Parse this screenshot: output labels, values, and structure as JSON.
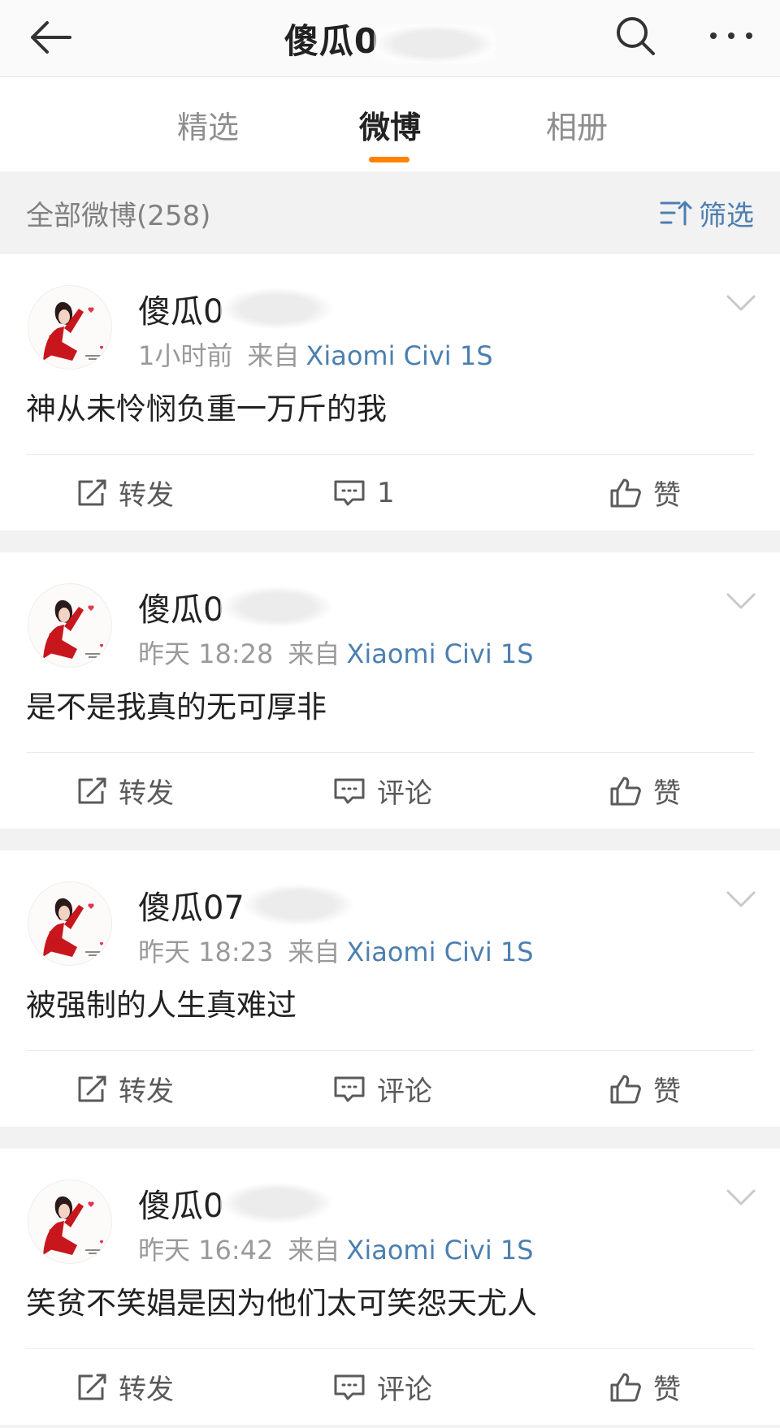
{
  "header": {
    "title": "傻瓜0",
    "back_icon": "arrow-left-icon",
    "search_icon": "search-icon",
    "more_icon": "more-dots-icon"
  },
  "tabs": [
    {
      "label": "精选",
      "active": false
    },
    {
      "label": "微博",
      "active": true
    },
    {
      "label": "相册",
      "active": false
    }
  ],
  "accent_color": "#ff8200",
  "link_color": "#4c7fb0",
  "filter_bar": {
    "count_label": "全部微博(258)",
    "filter_label": "筛选",
    "filter_icon": "filter-sort-icon"
  },
  "posts": [
    {
      "username": "傻瓜0",
      "time": "1小时前",
      "source_prefix": "来自",
      "device": "Xiaomi Civi 1S",
      "text": "神从未怜悯负重一万斤的我",
      "repost_label": "转发",
      "comment_label": "1",
      "like_label": "赞"
    },
    {
      "username": "傻瓜0",
      "time": "昨天 18:28",
      "source_prefix": "来自",
      "device": "Xiaomi Civi 1S",
      "text": "是不是我真的无可厚非",
      "repost_label": "转发",
      "comment_label": "评论",
      "like_label": "赞"
    },
    {
      "username": "傻瓜07",
      "time": "昨天 18:23",
      "source_prefix": "来自",
      "device": "Xiaomi Civi 1S",
      "text": "被强制的人生真难过",
      "repost_label": "转发",
      "comment_label": "评论",
      "like_label": "赞"
    },
    {
      "username": "傻瓜0",
      "time": "昨天 16:42",
      "source_prefix": "来自",
      "device": "Xiaomi Civi 1S",
      "text": "笑贫不笑娼是因为他们太可笑怨天尤人",
      "repost_label": "转发",
      "comment_label": "评论",
      "like_label": "赞"
    }
  ]
}
